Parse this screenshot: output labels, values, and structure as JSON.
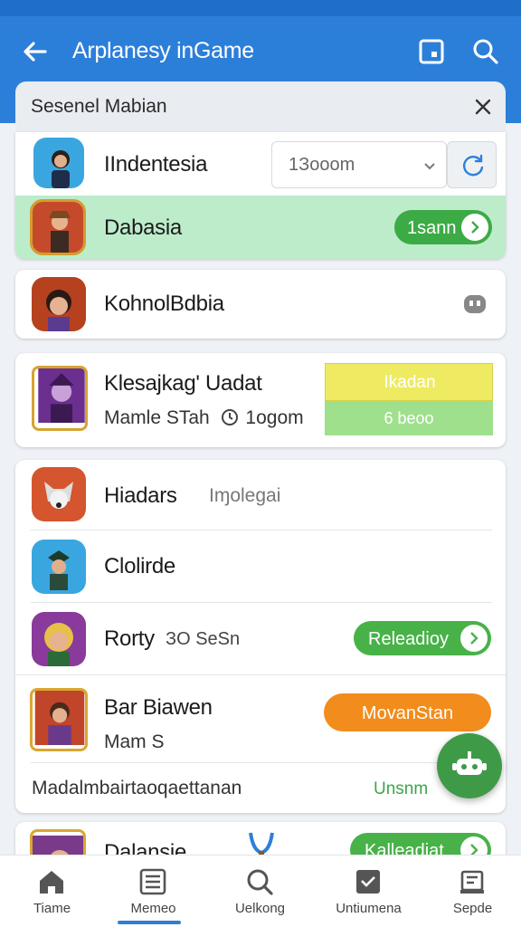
{
  "header": {
    "title": "Arplanesy inGame",
    "back_icon": "arrow-left-icon",
    "actions": [
      "window-icon",
      "search-icon"
    ],
    "color": "#2c7fd9"
  },
  "sheet": {
    "title": "Sesenel Mabian",
    "close_icon": "close-icon"
  },
  "items": {
    "indentesia": {
      "name": "IIndentesia",
      "select_value": "1Зooom",
      "action_icon": "refresh-icon"
    },
    "dabasia": {
      "name": "Dabasia",
      "button": "1sann",
      "highlight": "#bdeccb"
    },
    "kohnol": {
      "name": "KohnolBdbia",
      "trail_icon": "robot-icon"
    },
    "klesajkag": {
      "name": "Klesajkag' Uadat",
      "sub": "Mamle STah",
      "sub_meta": "1ogom",
      "btn_top": "Ikadan",
      "btn_bottom": "6 beoo"
    },
    "hiadars": {
      "name": "Hiadars",
      "tag": "Iɱolegai"
    },
    "clolirde": {
      "name": "Clolirde"
    },
    "rorty": {
      "name": "Rorty",
      "meta": "ЗO SeSn",
      "button": "Releadioy"
    },
    "barbiawen": {
      "name": "Bar Biawen",
      "sub": "Mam S",
      "button": "MovanStan"
    },
    "footer_row": {
      "text": "Madalmbairtaoqaettanan",
      "link": "Unsnm"
    },
    "dalansie": {
      "name": "Dalansie",
      "button": "Kalleadiat"
    }
  },
  "fab": {
    "icon": "robot-icon",
    "color": "#3f9a48"
  },
  "nav": {
    "items": [
      {
        "label": "Tiame",
        "icon": "home-icon"
      },
      {
        "label": "Memeo",
        "icon": "news-icon"
      },
      {
        "label": "Uelkong",
        "icon": "search-icon"
      },
      {
        "label": "Untiumena",
        "icon": "inbox-icon"
      },
      {
        "label": "Sepde",
        "icon": "settings-icon"
      }
    ],
    "active": "Memeo"
  }
}
